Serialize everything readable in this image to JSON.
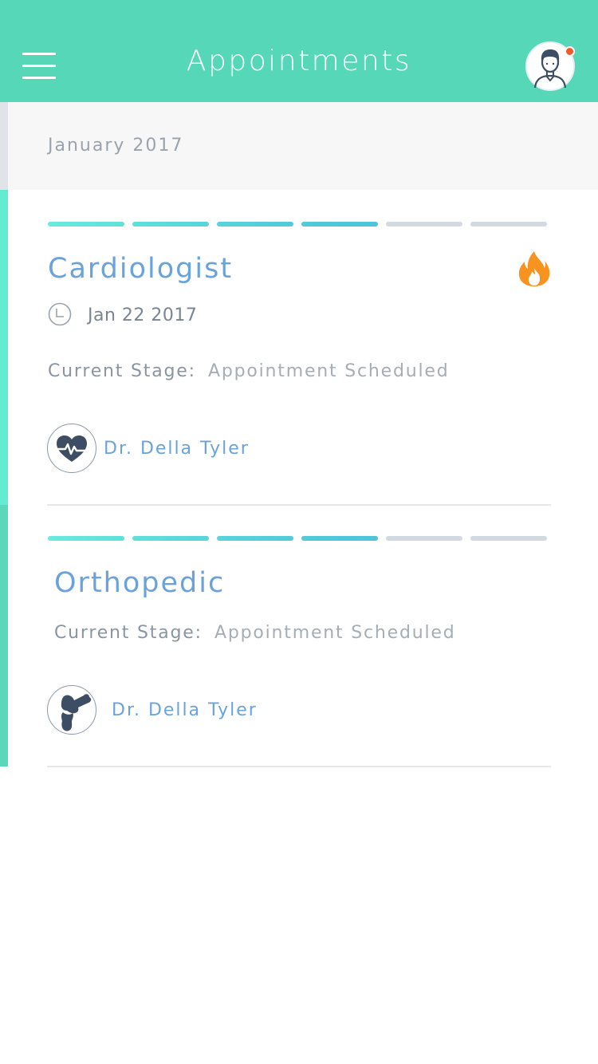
{
  "header": {
    "title": "Appointments",
    "menu_icon": "hamburger-menu-icon",
    "avatar_icon": "user-avatar-icon",
    "has_notification": true
  },
  "month": "January 2017",
  "colors": {
    "header_bg": "#56d8b8",
    "accent_teal": "#5fe8cc",
    "title_blue": "#6aa3dc",
    "progress_done": "#63e0dc",
    "progress_pending": "#d2d9e0",
    "hot_orange": "#f7931e",
    "notify_red": "#f05a28"
  },
  "appointments": [
    {
      "title": "Cardiologist",
      "hot_icon": "fire-icon",
      "date": "Jan 22 2017",
      "stage_label": "Current Stage:",
      "stage_value": "Appointment Scheduled",
      "progress": {
        "completed": 4,
        "total": 6
      },
      "doctor_icon": "heart-pulse-icon",
      "doctor": "Dr. Della Tyler"
    },
    {
      "title": "Orthopedic",
      "stage_label": "Current Stage:",
      "stage_value": "Appointment Scheduled",
      "progress": {
        "completed": 4,
        "total": 6
      },
      "doctor_icon": "bone-joint-icon",
      "doctor": "Dr. Della Tyler"
    }
  ]
}
